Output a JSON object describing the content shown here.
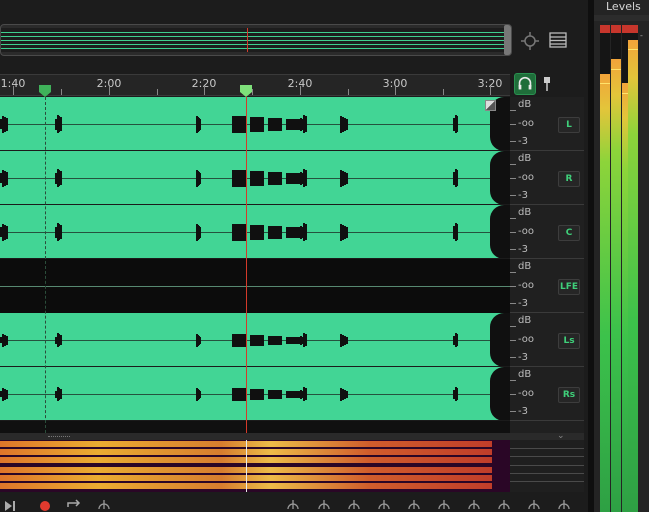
{
  "timeline": {
    "labels": [
      "1:40",
      "2:00",
      "2:20",
      "2:40",
      "3:00",
      "3:20"
    ]
  },
  "channels": [
    {
      "label": "L",
      "db_top": "dB",
      "db_mid": "-oo",
      "db_bot": "-3"
    },
    {
      "label": "R",
      "db_top": "dB",
      "db_mid": "-oo",
      "db_bot": "-3"
    },
    {
      "label": "C",
      "db_top": "dB",
      "db_mid": "-oo",
      "db_bot": "-3"
    },
    {
      "label": "LFE",
      "db_top": "dB",
      "db_mid": "-oo",
      "db_bot": "-3"
    },
    {
      "label": "Ls",
      "db_top": "dB",
      "db_mid": "-oo",
      "db_bot": "-3"
    },
    {
      "label": "Rs",
      "db_top": "dB",
      "db_mid": "-oo",
      "db_bot": "-3"
    }
  ],
  "levels": {
    "title": "Levels",
    "scale_top": "-",
    "meters": [
      {
        "name": "meter-1",
        "level": 0.9
      },
      {
        "name": "meter-2",
        "level": 0.93
      },
      {
        "name": "meter-3",
        "level": 0.88
      },
      {
        "name": "meter-4",
        "level": 0.97
      }
    ]
  },
  "icons": {
    "zoom": "zoom-to-selection-icon",
    "settings": "panel-menu-icon",
    "monitor": "headphones-monitor-icon",
    "pin": "pin-icon",
    "marker": "cue-marker-icon",
    "transport": [
      "skip-to-end-icon",
      "record-icon",
      "loop-icon",
      "skip-selection-icon",
      "zoom-in-amplitude-icon",
      "zoom-out-amplitude-icon",
      "zoom-in-time-icon",
      "zoom-out-time-icon",
      "zoom-full-icon",
      "zoom-selection-icon",
      "zoom-in-left-icon",
      "zoom-in-right-icon",
      "zoom-spectral-icon",
      "zoom-out-spectral-icon"
    ]
  },
  "colors": {
    "waveform": "#42d595",
    "playhead": "#d43a2a",
    "marker": "#3fb25a",
    "record": "#e03a2e"
  }
}
